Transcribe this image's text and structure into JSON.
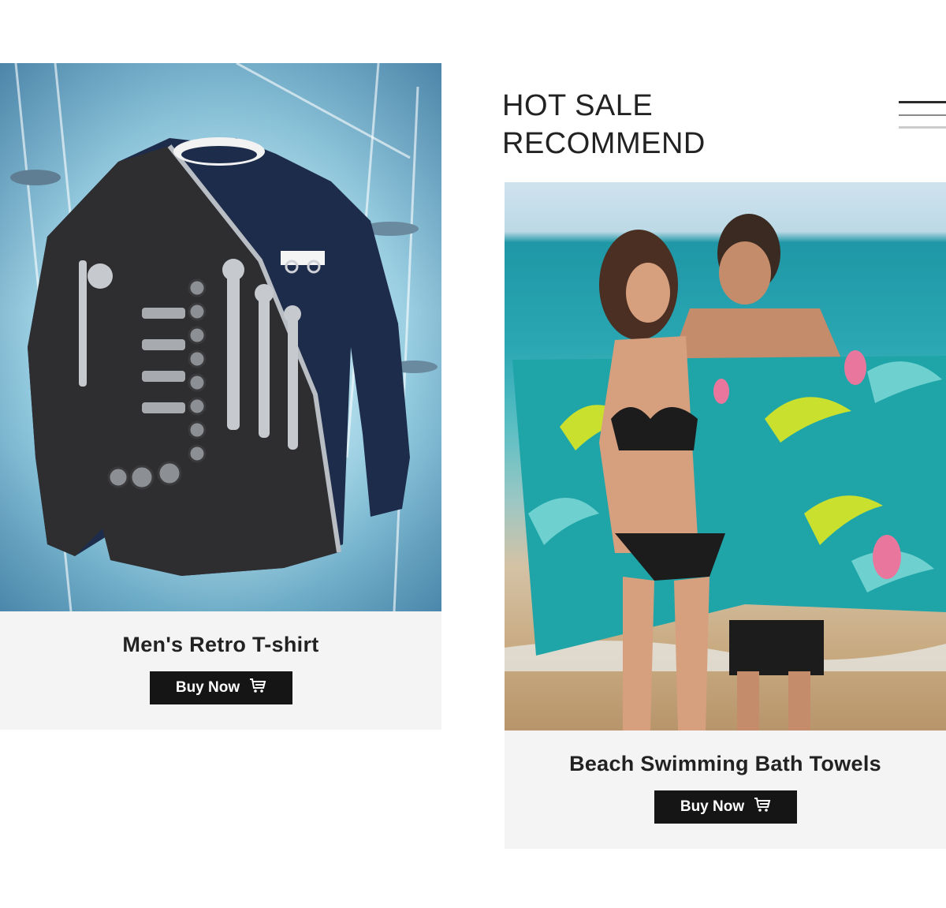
{
  "section": {
    "heading_line1": "HOT SALE",
    "heading_line2": "RECOMMEND"
  },
  "products": [
    {
      "title": "Men's Retro T-shirt",
      "button_label": "Buy Now",
      "button_icon": "cart-icon"
    },
    {
      "title": "Beach Swimming Bath Towels",
      "button_label": "Buy Now",
      "button_icon": "cart-icon"
    }
  ],
  "colors": {
    "button_bg": "#151515",
    "card_bg": "#f4f4f4",
    "heading_text": "#222222"
  }
}
